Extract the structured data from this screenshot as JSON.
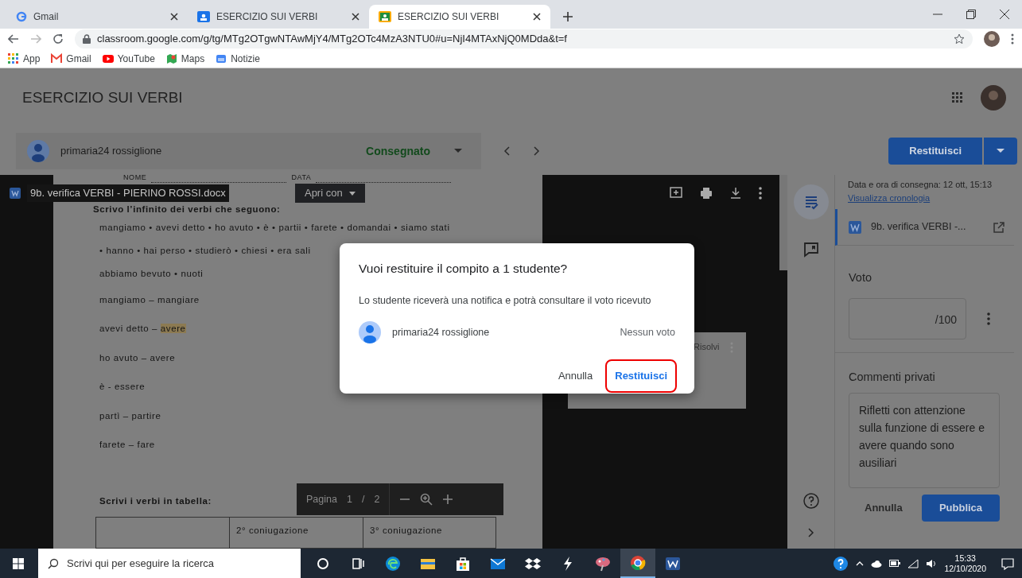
{
  "browser": {
    "tabs": [
      {
        "title": "Gmail",
        "kind": "gmail",
        "selected": false
      },
      {
        "title": "ESERCIZIO SUI VERBI",
        "kind": "classroom",
        "selected": false
      },
      {
        "title": "ESERCIZIO SUI VERBI",
        "kind": "classroom",
        "selected": true
      }
    ],
    "url": "classroom.google.com/g/tg/MTg2OTgwNTAwMjY4/MTg2OTc4MzA3NTU0#u=NjI4MTAxNjQ0MDda&t=f",
    "bookmarks": [
      {
        "label": "App",
        "kind": "apps"
      },
      {
        "label": "Gmail",
        "kind": "gmail"
      },
      {
        "label": "YouTube",
        "kind": "youtube"
      },
      {
        "label": "Maps",
        "kind": "maps"
      },
      {
        "label": "Notizie",
        "kind": "news"
      }
    ]
  },
  "header": {
    "title": "ESERCIZIO SUI VERBI",
    "student": "primaria24 rossiglione",
    "status": "Consegnato",
    "return_button": "Restituisci"
  },
  "viewer": {
    "file_name": "9b. verifica VERBI - PIERINO ROSSI.docx",
    "open_with": "Apri con",
    "document": {
      "name_label": "NOME",
      "date_label": "DATA",
      "instruction": "Scrivo l’infinito dei verbi che seguono:",
      "lines": [
        "mangiamo • avevi detto • ho avuto • è • partii • farete • domandai • siamo stati",
        "• hanno • hai perso • studierò • chiesi • era sali",
        "abbiamo bevuto • nuoti"
      ],
      "answers": [
        {
          "text": "mangiamo – mangiare"
        },
        {
          "text": "avevi detto – ",
          "highlighted_word": "avere"
        },
        {
          "text": "ho avuto – avere"
        },
        {
          "text": "è - essere"
        },
        {
          "text": "partì – partire"
        },
        {
          "text": "farete – fare"
        }
      ],
      "table_title": "Scrivi i verbi in tabella:",
      "table_columns": [
        "2° coniugazione",
        "3° coniugazione"
      ]
    },
    "comment_card": {
      "resolve": "Risolvi"
    },
    "pager": {
      "label": "Pagina",
      "page": "1",
      "separator": "/",
      "pages": "2"
    }
  },
  "rail": [
    {
      "kind": "details",
      "selected": true
    },
    {
      "kind": "comments",
      "selected": false
    }
  ],
  "panel": {
    "submitted": "Data e ora di consegna: 12 ott, 15:13",
    "history_link": "Visualizza cronologia",
    "attachment": "9b. verifica VERBI -...",
    "grade_label": "Voto",
    "grade_max": "/100",
    "comments_label": "Commenti privati",
    "comment": "Rifletti con attenzione sulla funzione di essere e avere quando sono ausiliari",
    "cancel": "Annulla",
    "publish": "Pubblica"
  },
  "dialog": {
    "title": "Vuoi restituire il compito a 1 studente?",
    "body": "Lo studente riceverà una notifica e potrà consultare il voto ricevuto",
    "student": "primaria24 rossiglione",
    "grade": "Nessun voto",
    "cancel": "Annulla",
    "confirm": "Restituisci",
    "confirm_highlighted": true
  },
  "taskbar": {
    "search_placeholder": "Scrivi qui per eseguire la ricerca",
    "apps": [
      {
        "kind": "cortana",
        "active": false
      },
      {
        "kind": "taskview",
        "active": false
      },
      {
        "kind": "edge",
        "active": false
      },
      {
        "kind": "explorer",
        "active": false
      },
      {
        "kind": "store",
        "active": false
      },
      {
        "kind": "mail",
        "active": false
      },
      {
        "kind": "dropbox",
        "active": false
      },
      {
        "kind": "bolt",
        "active": false
      },
      {
        "kind": "paint",
        "active": false
      },
      {
        "kind": "chrome",
        "active": true
      },
      {
        "kind": "word",
        "active": false
      }
    ],
    "time": "15:33",
    "date": "12/10/2020"
  }
}
